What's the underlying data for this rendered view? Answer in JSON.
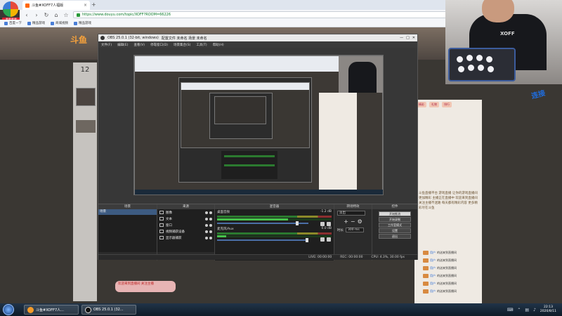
{
  "browser": {
    "logo_label": "看看看看",
    "tab_title": "斗鱼#XOFF7人福版",
    "url": "https://www.douyu.com/topic/XOFF?ROOM=66226",
    "bookmarks": [
      "百度一下",
      "精品游戏",
      "商城视频",
      "精品游戏"
    ]
  },
  "douyu": {
    "viewers": "12",
    "logo": "斗鱼",
    "right_tabs": [
      "精彩",
      "礼物",
      "排行"
    ],
    "right_text": "斗鱼直播平台 游戏直播 让你的游戏直播间更加精彩 主播正在直播中 欢迎来到直播间 关注主播不迷路 每天都有精彩内容 更多精彩尽在斗鱼",
    "chat": [
      {
        "name": "用户",
        "msg": "的送来到直播间"
      },
      {
        "name": "用户",
        "msg": "的送来到直播间"
      },
      {
        "name": "用户",
        "msg": "的送来到直播间"
      },
      {
        "name": "用户",
        "msg": "的送来到直播间"
      },
      {
        "name": "用户",
        "msg": "的送来到直播间"
      },
      {
        "name": "用户",
        "msg": "的送来到直播间"
      }
    ],
    "bottom_banner": "欢迎来到直播间 关注主播",
    "guide_badge": "连接"
  },
  "webcam": {
    "shirt_logo": "XOFF"
  },
  "obs": {
    "title": "OBS 25.0.1 (32-bit, windows)",
    "title_extra": "配置文件 未命名  场景 未命名",
    "menu": [
      "文件(F)",
      "编辑(E)",
      "查看(V)",
      "停靠窗口(D)",
      "场景集合(S)",
      "工具(T)",
      "帮助(H)"
    ],
    "docks": {
      "scenes_label": "场景",
      "sources_label": "来源",
      "mixer_label": "混音器",
      "transitions_label": "转场特效",
      "controls_label": "控件"
    },
    "scenes": [
      "场景"
    ],
    "sources": [
      "图像",
      "文本",
      "窗口",
      "视频捕获设备",
      "显示器捕获"
    ],
    "mixer": [
      {
        "name": "桌面音频",
        "db": "-1.2 dB"
      },
      {
        "name": "麦克风/Aux",
        "db": "0.0 dB"
      }
    ],
    "transition": {
      "type": "淡出",
      "duration_label": "时长",
      "duration": "300 ms"
    },
    "controls": [
      "开始推流",
      "开始录制",
      "工作室模式",
      "设置",
      "退出"
    ],
    "status": {
      "live": "LIVE: 00:00:00",
      "rec": "REC: 00:00:00",
      "cpu": "CPU: 4.3%, 30.00 fps"
    }
  },
  "taskbar": {
    "items": [
      {
        "label": "斗鱼#XOFF7人...",
        "color": "#f39b2a"
      },
      {
        "label": "OBS 25.0.1 (32...",
        "color": "#111111"
      }
    ],
    "time": "22:13",
    "date": "2020/8/11"
  }
}
